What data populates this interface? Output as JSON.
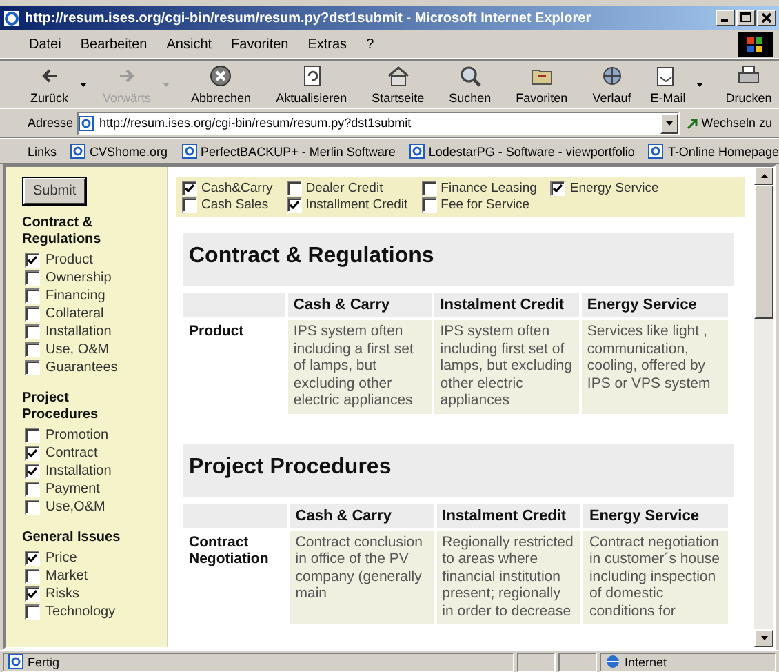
{
  "window": {
    "title": "http://resum.ises.org/cgi-bin/resum/resum.py?dst1submit - Microsoft Internet Explorer"
  },
  "menu": [
    "Datei",
    "Bearbeiten",
    "Ansicht",
    "Favoriten",
    "Extras",
    "?"
  ],
  "toolbar": [
    {
      "label": "Zurück",
      "kind": "back",
      "disabled": false,
      "dropdown": true
    },
    {
      "label": "Vorwärts",
      "kind": "forward",
      "disabled": true,
      "dropdown": true
    },
    {
      "label": "Abbrechen",
      "kind": "stop",
      "disabled": false,
      "dropdown": false
    },
    {
      "label": "Aktualisieren",
      "kind": "refresh",
      "disabled": false,
      "dropdown": false
    },
    {
      "label": "Startseite",
      "kind": "home",
      "disabled": false,
      "dropdown": false
    },
    {
      "label": "Suchen",
      "kind": "search",
      "disabled": false,
      "dropdown": false
    },
    {
      "label": "Favoriten",
      "kind": "favorites",
      "disabled": false,
      "dropdown": false
    },
    {
      "label": "Verlauf",
      "kind": "history",
      "disabled": false,
      "dropdown": false
    },
    {
      "label": "E-Mail",
      "kind": "mail",
      "disabled": false,
      "dropdown": true
    },
    {
      "label": "Drucken",
      "kind": "print",
      "disabled": false,
      "dropdown": false
    }
  ],
  "address": {
    "label": "Adresse",
    "value": "http://resum.ises.org/cgi-bin/resum/resum.py?dst1submit",
    "go": "Wechseln zu"
  },
  "links": {
    "label": "Links",
    "items": [
      "CVShome.org",
      "PerfectBACKUP+ - Merlin Software",
      "LodestarPG - Software - viewportfolio",
      "T-Online Homepage"
    ]
  },
  "sidebar": {
    "submit": "Submit",
    "groups": [
      {
        "title": "Contract & Regulations",
        "items": [
          {
            "label": "Product",
            "checked": true
          },
          {
            "label": "Ownership",
            "checked": false
          },
          {
            "label": "Financing",
            "checked": false
          },
          {
            "label": "Collateral",
            "checked": false
          },
          {
            "label": "Installation",
            "checked": false
          },
          {
            "label": "Use, O&M",
            "checked": false
          },
          {
            "label": "Guarantees",
            "checked": false
          }
        ]
      },
      {
        "title": "Project Procedures",
        "items": [
          {
            "label": "Promotion",
            "checked": false
          },
          {
            "label": "Contract",
            "checked": true
          },
          {
            "label": "Installation",
            "checked": true
          },
          {
            "label": "Payment",
            "checked": false
          },
          {
            "label": "Use,O&M",
            "checked": false
          }
        ]
      },
      {
        "title": "General Issues",
        "items": [
          {
            "label": "Price",
            "checked": true
          },
          {
            "label": "Market",
            "checked": false
          },
          {
            "label": "Risks",
            "checked": true
          },
          {
            "label": "Technology",
            "checked": false
          }
        ]
      }
    ]
  },
  "filters": [
    {
      "label": "Cash&Carry",
      "checked": true
    },
    {
      "label": "Dealer Credit",
      "checked": false
    },
    {
      "label": "Finance Leasing",
      "checked": false
    },
    {
      "label": "Energy Service",
      "checked": true
    },
    {
      "label": "Cash Sales",
      "checked": false
    },
    {
      "label": "Installment Credit",
      "checked": true
    },
    {
      "label": "Fee for Service",
      "checked": false
    }
  ],
  "sections": [
    {
      "title": "Contract & Regulations",
      "columns": [
        "Cash & Carry",
        "Instalment Credit",
        "Energy Service"
      ],
      "rows": [
        {
          "label": "Product",
          "cells": [
            "IPS system often including a first set of lamps, but excluding other electric appliances",
            "IPS system often including first set of lamps, but excluding other electric appliances",
            "Services like light , communication, cooling, offered by IPS or VPS system"
          ]
        }
      ]
    },
    {
      "title": "Project Procedures",
      "columns": [
        "Cash & Carry",
        "Instalment Credit",
        "Energy Service"
      ],
      "rows": [
        {
          "label": "Contract Negotiation",
          "cells": [
            "Contract conclusion in office of the PV company (generally main",
            "Regionally restricted to areas where financial institution present; regionally in order to decrease",
            "Contract negotiation in customer´s house including inspection of domestic conditions for"
          ]
        }
      ]
    }
  ],
  "status_bar": {
    "text": "Fertig",
    "zone": "Internet"
  }
}
